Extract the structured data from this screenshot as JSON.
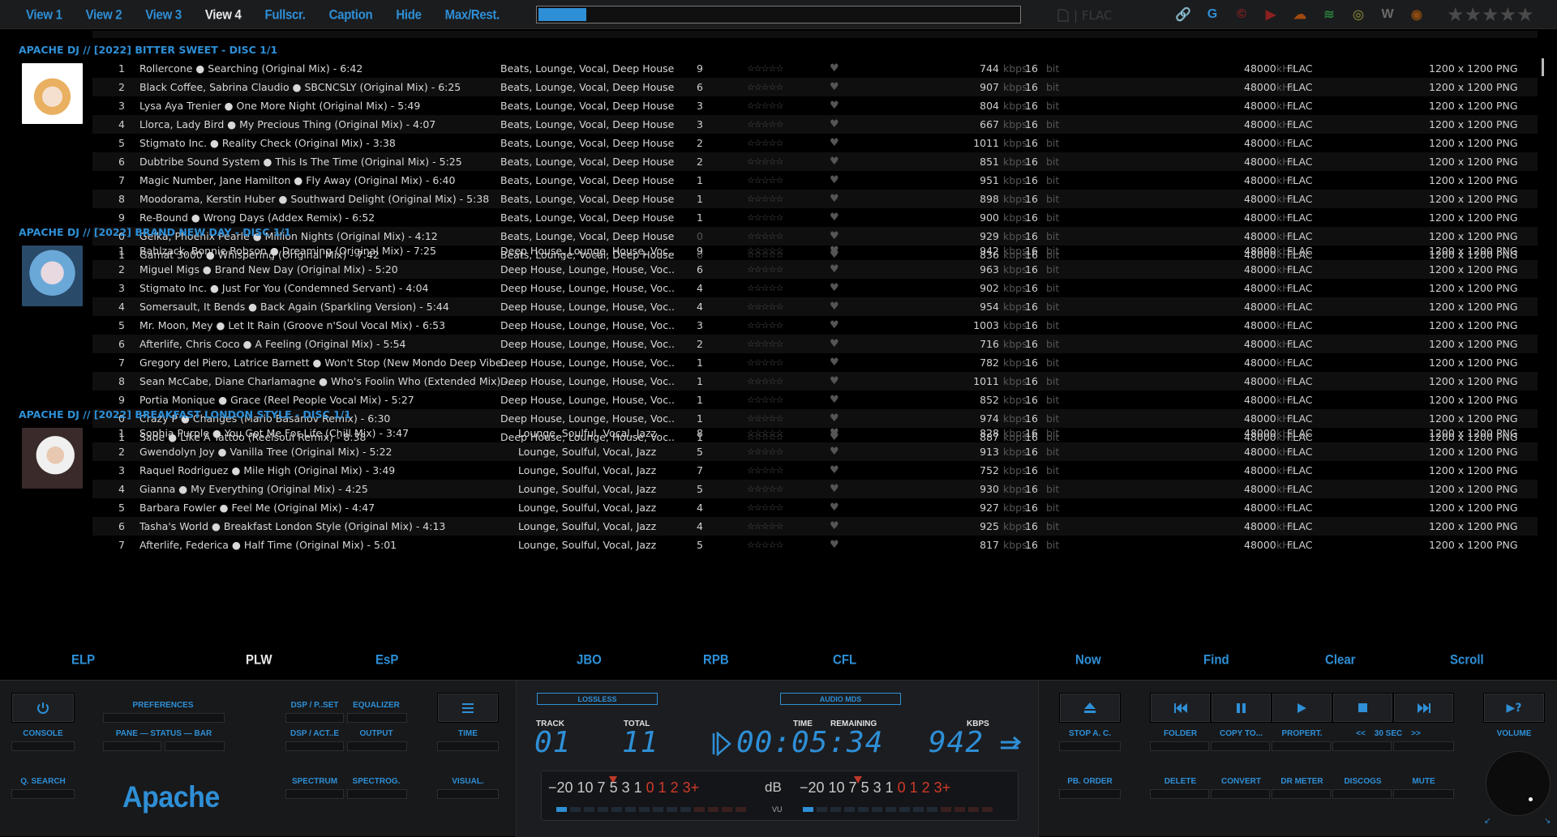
{
  "topbar": {
    "views": [
      "View 1",
      "View 2",
      "View 3",
      "View 4",
      "Fullscr.",
      "Caption",
      "Hide",
      "Max/Rest."
    ],
    "active_view": 3,
    "seek_progress": 0.1,
    "format_label": "| FLAC",
    "services": [
      "chain-link-icon",
      "google-icon",
      "lastfm-icon",
      "youtube-icon",
      "soundcloud-icon",
      "spotify-icon",
      "discogs-icon",
      "wikipedia-icon",
      "podcast-icon"
    ],
    "rating_stars": 5
  },
  "groups": [
    {
      "header": "APACHE DJ // [2022] BITTER SWEET - DISC 1/1",
      "genre_col": "left",
      "tracks": [
        {
          "n": "1",
          "title": "Rollercone ● Searching (Original Mix) - 6:42",
          "genre": "Beats, Lounge, Vocal, Deep House",
          "pc": "9",
          "kbps": "744"
        },
        {
          "n": "2",
          "title": "Black Coffee, Sabrina Claudio ● SBCNCSLY (Original Mix) - 6:25",
          "genre": "Beats, Lounge, Vocal, Deep House",
          "pc": "6",
          "kbps": "907"
        },
        {
          "n": "3",
          "title": "Lysa Aya Trenier ● One More Night (Original Mix) - 5:49",
          "genre": "Beats, Lounge, Vocal, Deep House",
          "pc": "3",
          "kbps": "804"
        },
        {
          "n": "4",
          "title": "Llorca, Lady Bird ● My Precious Thing (Original Mix) - 4:07",
          "genre": "Beats, Lounge, Vocal, Deep House",
          "pc": "3",
          "kbps": "667"
        },
        {
          "n": "5",
          "title": "Stigmato Inc. ● Reality Check (Original Mix) - 3:38",
          "genre": "Beats, Lounge, Vocal, Deep House",
          "pc": "2",
          "kbps": "1011"
        },
        {
          "n": "6",
          "title": "Dubtribe Sound System ● This Is The Time (Original Mix) - 5:25",
          "genre": "Beats, Lounge, Vocal, Deep House",
          "pc": "2",
          "kbps": "851"
        },
        {
          "n": "7",
          "title": "Magic Number, Jane Hamilton ● Fly Away (Original Mix) - 6:40",
          "genre": "Beats, Lounge, Vocal, Deep House",
          "pc": "1",
          "kbps": "951"
        },
        {
          "n": "8",
          "title": "Moodorama, Kerstin Huber ● Southward Delight (Original Mix) - 5:38",
          "genre": "Beats, Lounge, Vocal, Deep House",
          "pc": "1",
          "kbps": "898"
        },
        {
          "n": "9",
          "title": "Re-Bound ● Wrong Days (Addex Remix) - 6:52",
          "genre": "Beats, Lounge, Vocal, Deep House",
          "pc": "1",
          "kbps": "900"
        },
        {
          "n": "0",
          "title": "Gelka, Phoenix Pearle ● Million Nights (Original Mix) - 4:12",
          "genre": "Beats, Lounge, Vocal, Deep House",
          "pc": "0",
          "kbps": "929"
        },
        {
          "n": "1",
          "title": "Gamat 3000 ● Whispering (Original Mix) - 7:42",
          "genre": "Beats, Lounge, Vocal, Deep House",
          "pc": "0",
          "kbps": "836"
        }
      ]
    },
    {
      "header": "APACHE DJ // [2022] BRAND NEW DAY - DISC 1/1",
      "genre_col": "left",
      "tracks": [
        {
          "n": "1",
          "title": "Bahlzack, Bonnie Robson ● Dreaming (Original Mix) - 7:25",
          "genre": "Deep House, Lounge, House, Voc...",
          "pc": "9",
          "kbps": "942"
        },
        {
          "n": "2",
          "title": "Miguel Migs ● Brand New Day (Original Mix) - 5:20",
          "genre": "Deep House, Lounge, House, Voc...",
          "pc": "6",
          "kbps": "963"
        },
        {
          "n": "3",
          "title": "Stigmato Inc. ● Just For You (Condemned Servant) - 4:04",
          "genre": "Deep House, Lounge, House, Voc...",
          "pc": "4",
          "kbps": "902"
        },
        {
          "n": "4",
          "title": "Somersault, It Bends ● Back Again (Sparkling Version) - 5:44",
          "genre": "Deep House, Lounge, House, Voc...",
          "pc": "4",
          "kbps": "954"
        },
        {
          "n": "5",
          "title": "Mr. Moon, Mey ● Let It Rain (Groove n'Soul Vocal Mix) - 6:53",
          "genre": "Deep House, Lounge, House, Voc...",
          "pc": "3",
          "kbps": "1003"
        },
        {
          "n": "6",
          "title": "Afterlife, Chris Coco ● A Feeling (Original Mix) - 5:54",
          "genre": "Deep House, Lounge, House, Voc...",
          "pc": "2",
          "kbps": "716"
        },
        {
          "n": "7",
          "title": "Gregory del Piero, Latrice Barnett ● Won't Stop (New Mondo Deep Vibe ...",
          "genre": "Deep House, Lounge, House, Voc...",
          "pc": "1",
          "kbps": "782"
        },
        {
          "n": "8",
          "title": "Sean McCabe, Diane Charlamagne ● Who's Foolin Who (Extended Mix) -...",
          "genre": "Deep House, Lounge, House, Voc...",
          "pc": "1",
          "kbps": "1011"
        },
        {
          "n": "9",
          "title": "Portia Monique ● Grace (Reel People Vocal Mix) - 5:27",
          "genre": "Deep House, Lounge, House, Voc...",
          "pc": "1",
          "kbps": "852"
        },
        {
          "n": "0",
          "title": "Crazy P ● Changes (Mario Basanov Remix) - 6:30",
          "genre": "Deep House, Lounge, House, Voc...",
          "pc": "1",
          "kbps": "974"
        },
        {
          "n": "1",
          "title": "Sade ● Like A Tattoo (Reelsoul Remix) - 8:38",
          "genre": "Deep House, Lounge, House, Voc...",
          "pc": "1",
          "kbps": "887"
        }
      ]
    },
    {
      "header": "APACHE DJ // [2022] BREAKFAST LONDON STYLE - DISC 1/1",
      "genre_col": "right",
      "tracks": [
        {
          "n": "1",
          "title": "Sophia Purple ● You Got Me For Life (Chill Mix) - 3:47",
          "genre": "Lounge, Soulful, Vocal, Jazz",
          "pc": "8",
          "kbps": "828"
        },
        {
          "n": "2",
          "title": "Gwendolyn Joy ● Vanilla Tree (Original Mix) - 5:22",
          "genre": "Lounge, Soulful, Vocal, Jazz",
          "pc": "5",
          "kbps": "913"
        },
        {
          "n": "3",
          "title": "Raquel Rodriguez ● Mile High (Original Mix) - 3:49",
          "genre": "Lounge, Soulful, Vocal, Jazz",
          "pc": "7",
          "kbps": "752"
        },
        {
          "n": "4",
          "title": "Gianna ● My Everything (Original Mix) - 4:25",
          "genre": "Lounge, Soulful, Vocal, Jazz",
          "pc": "5",
          "kbps": "930"
        },
        {
          "n": "5",
          "title": "Barbara Fowler ● Feel Me (Original Mix) - 4:47",
          "genre": "Lounge, Soulful, Vocal, Jazz",
          "pc": "4",
          "kbps": "927"
        },
        {
          "n": "6",
          "title": "Tasha's World ● Breakfast London Style (Original Mix) - 4:13",
          "genre": "Lounge, Soulful, Vocal, Jazz",
          "pc": "4",
          "kbps": "925"
        },
        {
          "n": "7",
          "title": "Afterlife, Federica ● Half Time (Original Mix) - 5:01",
          "genre": "Lounge, Soulful, Vocal, Jazz",
          "pc": "5",
          "kbps": "817"
        }
      ]
    }
  ],
  "track_common": {
    "rating": "☆☆☆☆☆",
    "kbps_unit": "kbps",
    "bits": "16",
    "bit_unit": "bit",
    "khz": "48000",
    "khz_unit": "kHz",
    "format": "FLAC",
    "art_res": "1200 x 1200 PNG"
  },
  "tabs": [
    "ELP",
    "PLW",
    "EsP",
    "JBO",
    "RPB",
    "CFL",
    "Now",
    "Find",
    "Clear",
    "Scroll"
  ],
  "active_tab": 1,
  "left_panel": {
    "preferences": "PREFERENCES",
    "console": "CONSOLE",
    "pane_status_bar": "PANE — STATUS — BAR",
    "q_search": "Q. SEARCH",
    "dsp_pset": "DSP / P..SET",
    "equalizer": "EQUALIZER",
    "dsp_act": "DSP / ACT..E",
    "output": "OUTPUT",
    "spectrum": "SPECTRUM",
    "spectrog": "SPECTROG.",
    "time": "TIME",
    "visual": "VISUAL.",
    "brand": "Apache"
  },
  "center_panel": {
    "lossless": "LOSSLESS",
    "audio_mds": "AUDIO MDS",
    "track_label": "TRACK",
    "track_value": "01",
    "total_label": "TOTAL",
    "total_value": "11",
    "time_label": "TIME",
    "remaining_label": "REMAINING",
    "time_value": "00:05:34",
    "kbps_label": "KBPS",
    "kbps_value": "942",
    "vu_scale_left": "−20 10 7   5   3     1",
    "vu_scale_red": "0 1 2 3+",
    "vu_db": "dB",
    "vu_label": "VU",
    "vu_level_left": 1,
    "vu_level_right": 1
  },
  "right_panel": {
    "stop_ac": "STOP A. C.",
    "pb_order": "PB. ORDER",
    "folder": "FOLDER",
    "copy_to": "COPY TO...",
    "propert": "PROPERT.",
    "seek_back": "<<",
    "seek_interval": "30 SEC",
    "seek_fwd": ">>",
    "delete": "DELETE",
    "convert": "CONVERT",
    "dr_meter": "DR METER",
    "discogs": "DISCOGS",
    "mute": "MUTE",
    "volume": "VOLUME",
    "help": "▶?"
  },
  "colors": {
    "accent": "#2e8fd6",
    "bg": "#000000",
    "panel": "#18191b",
    "red": "#d03a2a"
  }
}
